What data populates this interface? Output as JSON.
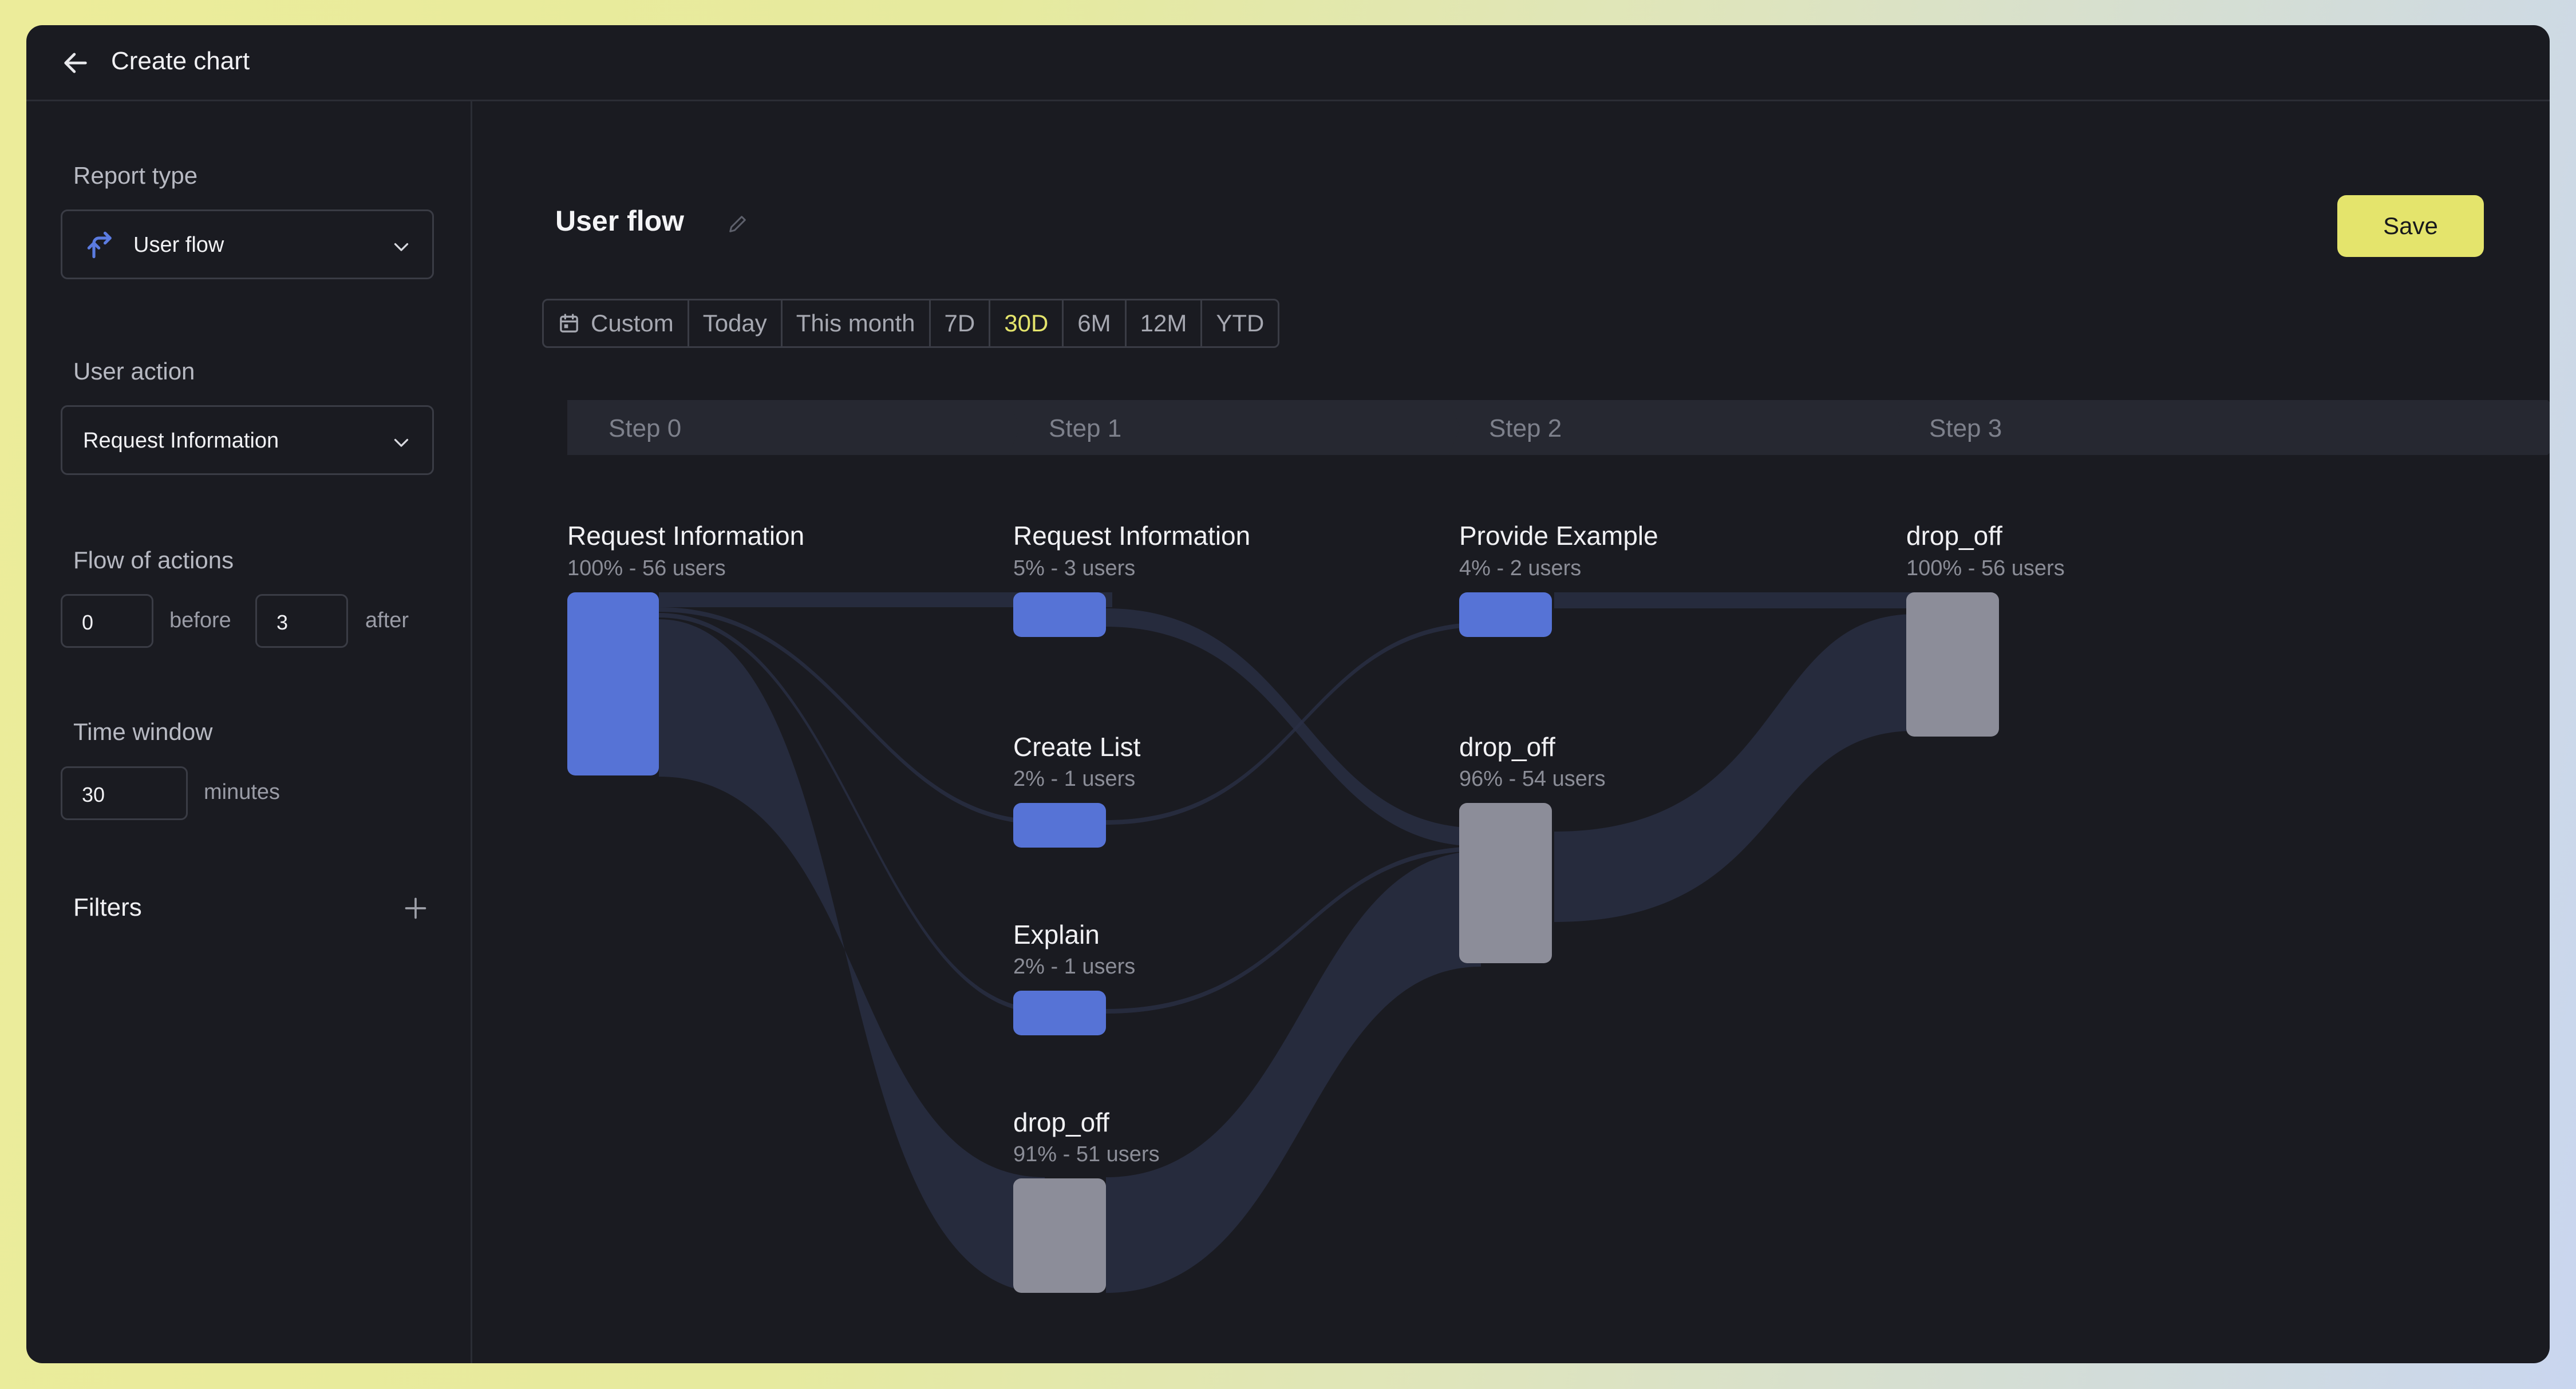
{
  "header": {
    "title": "Create chart",
    "back_icon": "arrow-left-icon"
  },
  "sidebar": {
    "report_type": {
      "label": "Report type",
      "value": "User flow",
      "icon": "user-flow-icon"
    },
    "user_action": {
      "label": "User action",
      "value": "Request Information"
    },
    "flow_of_actions": {
      "label": "Flow of actions",
      "before_value": "0",
      "before_label": "before",
      "after_value": "3",
      "after_label": "after"
    },
    "time_window": {
      "label": "Time window",
      "value": "30",
      "unit": "minutes"
    },
    "filters": {
      "label": "Filters",
      "add_icon": "plus-icon"
    }
  },
  "main": {
    "title": "User flow",
    "save_label": "Save",
    "ranges": [
      {
        "label": "Custom",
        "icon": "calendar-icon"
      },
      {
        "label": "Today"
      },
      {
        "label": "This month"
      },
      {
        "label": "7D"
      },
      {
        "label": "30D",
        "active": true
      },
      {
        "label": "6M"
      },
      {
        "label": "12M"
      },
      {
        "label": "YTD"
      }
    ]
  },
  "colors": {
    "action_node": "#5673d6",
    "dropoff_node": "#8c8d99",
    "link": "#2a3045",
    "accent": "#e4e46c"
  },
  "flow": {
    "steps": [
      "Step 0",
      "Step 1",
      "Step 2",
      "Step 3"
    ],
    "nodes": [
      {
        "step": 0,
        "name": "Request Information",
        "sub": "100% - 56 users",
        "users": 56,
        "kind": "action"
      },
      {
        "step": 1,
        "name": "Request Information",
        "sub": "5% - 3 users",
        "users": 3,
        "kind": "action"
      },
      {
        "step": 1,
        "name": "Create List",
        "sub": "2% - 1 users",
        "users": 1,
        "kind": "action"
      },
      {
        "step": 1,
        "name": "Explain",
        "sub": "2% - 1 users",
        "users": 1,
        "kind": "action"
      },
      {
        "step": 1,
        "name": "drop_off",
        "sub": "91% - 51 users",
        "users": 51,
        "kind": "dropoff"
      },
      {
        "step": 2,
        "name": "Provide Example",
        "sub": "4% - 2 users",
        "users": 2,
        "kind": "action"
      },
      {
        "step": 2,
        "name": "drop_off",
        "sub": "96% - 54 users",
        "users": 54,
        "kind": "dropoff"
      },
      {
        "step": 3,
        "name": "drop_off",
        "sub": "100% - 56 users",
        "users": 56,
        "kind": "dropoff"
      }
    ]
  }
}
